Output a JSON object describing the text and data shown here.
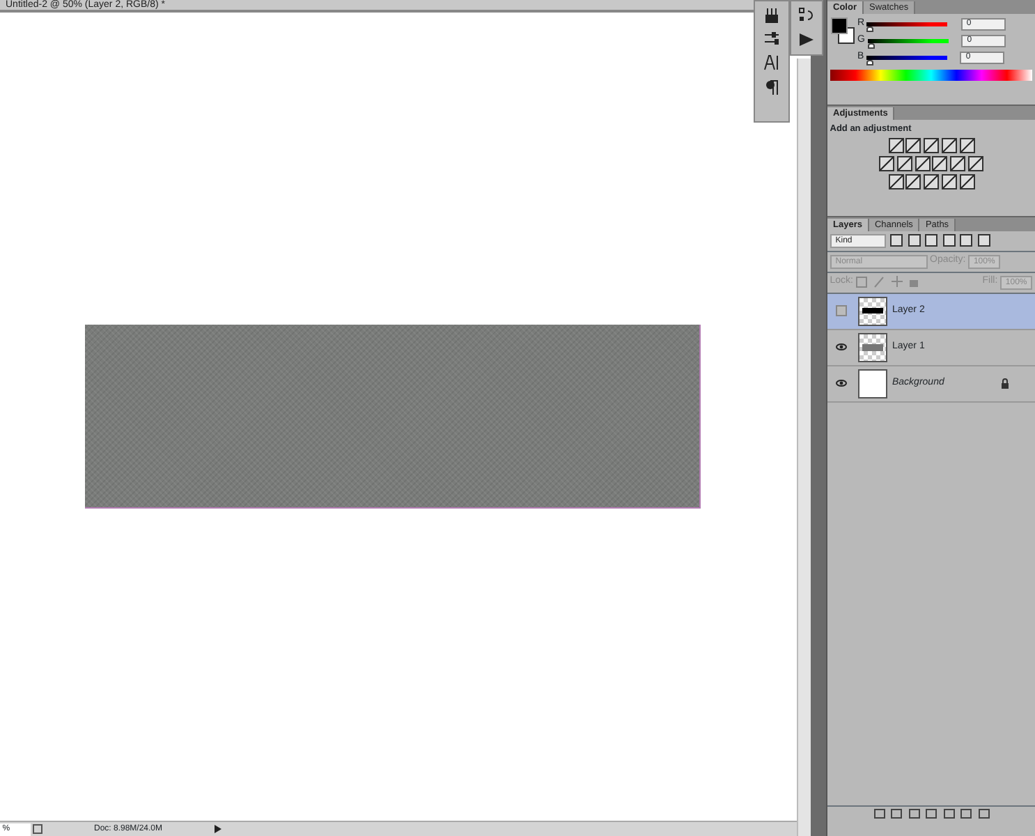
{
  "document": {
    "title": "Untitled-2 @ 50% (Layer 2, RGB/8) *"
  },
  "status_bar": {
    "zoom": "%",
    "doc_info": "Doc: 8.98M/24.0M"
  },
  "color_panel": {
    "tabs": [
      {
        "label": "Color",
        "selected": true
      },
      {
        "label": "Swatches",
        "selected": false
      }
    ],
    "channels": [
      {
        "label": "R",
        "value": "0",
        "level": 0,
        "color": "#ff0000"
      },
      {
        "label": "G",
        "value": "0",
        "level": 0,
        "color": "#00ff00"
      },
      {
        "label": "B",
        "value": "0",
        "level": 0,
        "color": "#0000ff"
      }
    ]
  },
  "adjustments_panel": {
    "tab": "Adjustments",
    "heading": "Add an adjustment"
  },
  "layers_panel": {
    "tabs": [
      {
        "label": "Layers",
        "selected": true
      },
      {
        "label": "Channels",
        "selected": false
      },
      {
        "label": "Paths",
        "selected": false
      }
    ],
    "filter": "Kind",
    "blend_mode": "Normal",
    "opacity_label": "Opacity:",
    "opacity": "100%",
    "lock_label": "Lock:",
    "fill_label": "Fill:",
    "fill": "100%",
    "layers": [
      {
        "name": "Layer 2",
        "kind": "bar",
        "visible": false,
        "selected": true,
        "locked": false,
        "italic": false
      },
      {
        "name": "Layer 1",
        "kind": "gray",
        "visible": true,
        "selected": false,
        "locked": false,
        "italic": false
      },
      {
        "name": "Background",
        "kind": "white",
        "visible": true,
        "selected": false,
        "locked": true,
        "italic": true
      }
    ]
  }
}
